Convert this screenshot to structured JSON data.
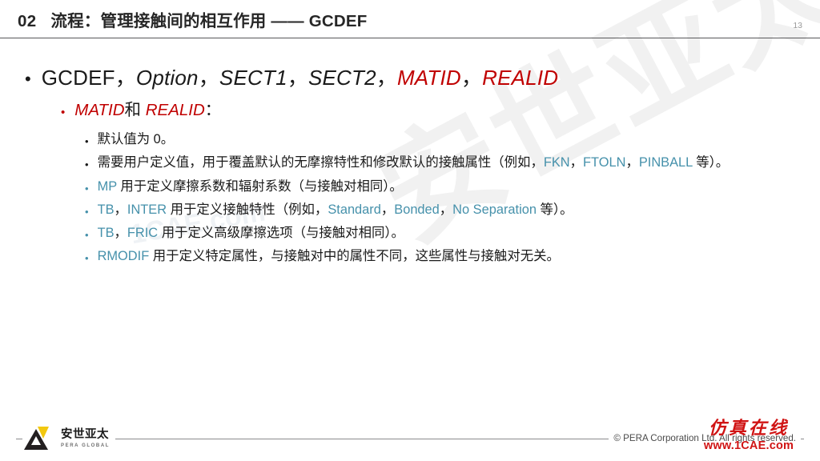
{
  "slide": {
    "page_number": "13",
    "header": {
      "section_number": "02",
      "title": "流程：管理接触间的相互作用 —— GCDEF"
    },
    "watermark_large": "安世亚太",
    "watermark_small": "1CAE.com",
    "bullet_l1": {
      "marker": "•",
      "parts": [
        {
          "text": "GCDEF",
          "style": "plain"
        },
        {
          "text": "，",
          "style": "plain"
        },
        {
          "text": "Option",
          "style": "italic"
        },
        {
          "text": "，",
          "style": "plain"
        },
        {
          "text": "SECT1",
          "style": "italic"
        },
        {
          "text": "，",
          "style": "plain"
        },
        {
          "text": "SECT2",
          "style": "italic"
        },
        {
          "text": "，",
          "style": "plain"
        },
        {
          "text": "MATID",
          "style": "red-italic"
        },
        {
          "text": "，",
          "style": "plain"
        },
        {
          "text": "REALID",
          "style": "red-italic"
        }
      ]
    },
    "bullet_l2": {
      "marker": "•",
      "parts": [
        {
          "text": "MATID",
          "style": "red-italic"
        },
        {
          "text": "和 ",
          "style": "plain"
        },
        {
          "text": "REALID",
          "style": "red-italic"
        },
        {
          "text": "：",
          "style": "plain"
        }
      ]
    },
    "bullets_l3": [
      {
        "marker": "•",
        "marker_color": "dark",
        "parts": [
          {
            "text": "默认值为 0。",
            "style": "plain"
          }
        ]
      },
      {
        "marker": "•",
        "marker_color": "dark",
        "parts": [
          {
            "text": "需要用户定义值，用于覆盖默认的无摩擦特性和修改默认的接触属性（例如，",
            "style": "plain"
          },
          {
            "text": "FKN",
            "style": "token"
          },
          {
            "text": "，",
            "style": "plain"
          },
          {
            "text": "FTOLN",
            "style": "token"
          },
          {
            "text": "，",
            "style": "plain"
          },
          {
            "text": "PINBALL",
            "style": "token"
          },
          {
            "text": " 等）。",
            "style": "plain"
          }
        ]
      },
      {
        "marker": "•",
        "marker_color": "token",
        "parts": [
          {
            "text": "MP",
            "style": "token"
          },
          {
            "text": " 用于定义摩擦系数和辐射系数（与接触对相同）。",
            "style": "plain"
          }
        ]
      },
      {
        "marker": "•",
        "marker_color": "token",
        "parts": [
          {
            "text": "TB",
            "style": "token"
          },
          {
            "text": "，",
            "style": "plain"
          },
          {
            "text": "INTER",
            "style": "token"
          },
          {
            "text": " 用于定义接触特性（例如，",
            "style": "plain"
          },
          {
            "text": "Standard",
            "style": "token"
          },
          {
            "text": "，",
            "style": "plain"
          },
          {
            "text": "Bonded",
            "style": "token"
          },
          {
            "text": "，",
            "style": "plain"
          },
          {
            "text": "No Separation",
            "style": "token"
          },
          {
            "text": " 等）。",
            "style": "plain"
          }
        ]
      },
      {
        "marker": "•",
        "marker_color": "token",
        "parts": [
          {
            "text": "TB",
            "style": "token"
          },
          {
            "text": "，",
            "style": "plain"
          },
          {
            "text": "FRIC",
            "style": "token"
          },
          {
            "text": " 用于定义高级摩擦选项（与接触对相同）。",
            "style": "plain"
          }
        ]
      },
      {
        "marker": "•",
        "marker_color": "token",
        "parts": [
          {
            "text": "RMODIF",
            "style": "token"
          },
          {
            "text": " 用于定义特定属性，与接触对中的属性不同，这些属性与接触对无关。",
            "style": "plain"
          }
        ]
      }
    ],
    "footer": {
      "logo_cn": "安世亚太",
      "logo_en": "PERA GLOBAL",
      "copyright": "© PERA Corporation Ltd. All rights reserved.",
      "watermark_brand_cn": "仿真在线",
      "watermark_brand_url": "www.1CAE.com"
    },
    "colors": {
      "accent_red": "#c00000",
      "token_blue": "#4691ab",
      "logo_yellow": "#f2c80f",
      "logo_dark": "#231f20",
      "watermark_red": "#d01414"
    }
  }
}
